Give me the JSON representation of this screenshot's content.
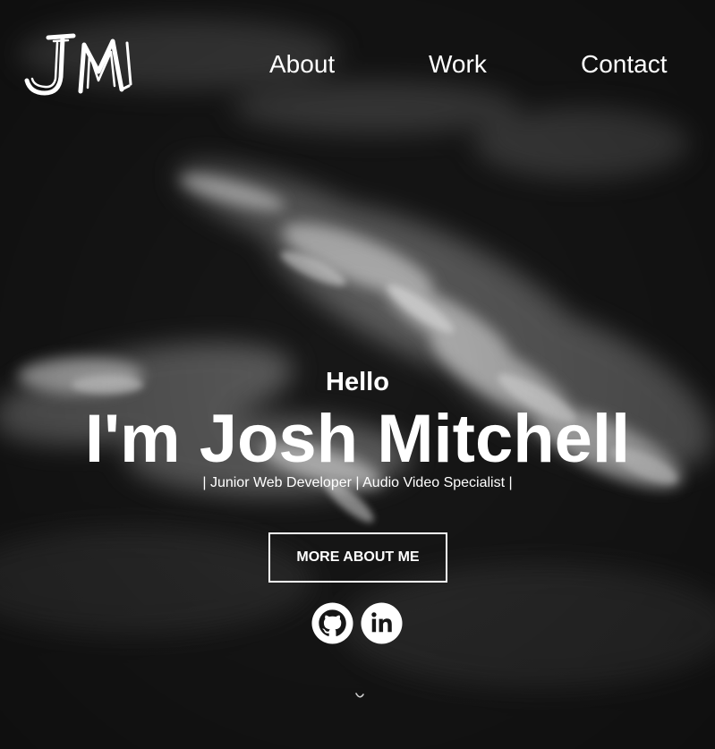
{
  "logo": {
    "text": "JM"
  },
  "nav": {
    "items": [
      {
        "label": "About"
      },
      {
        "label": "Work"
      },
      {
        "label": "Contact"
      }
    ]
  },
  "hero": {
    "greeting": "Hello",
    "name": "I'm Josh Mitchell",
    "tagline": "| Junior Web Developer | Audio Video Specialist |",
    "cta_label": "MORE ABOUT ME"
  },
  "social": [
    {
      "icon": "github-icon"
    },
    {
      "icon": "linkedin-icon"
    }
  ],
  "colors": {
    "background": "#161616",
    "text": "#ffffff",
    "cloud": "#e8e8e8"
  }
}
